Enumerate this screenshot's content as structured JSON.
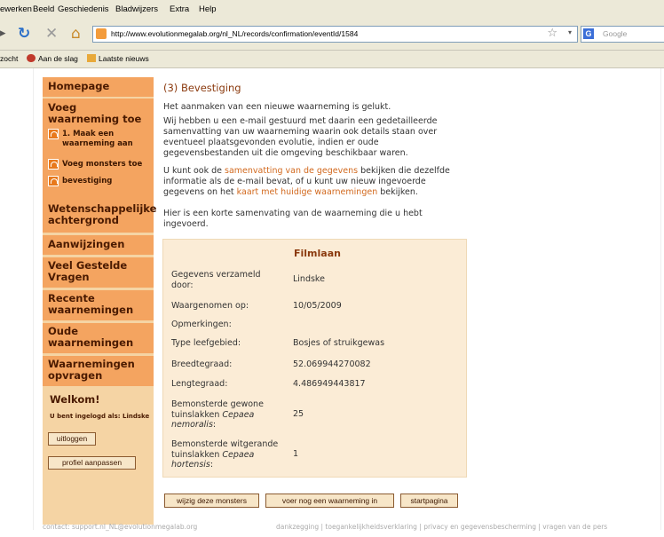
{
  "menu": [
    "ewerken",
    "Beeld",
    "Geschiedenis",
    "Bladwijzers",
    "Extra",
    "Help"
  ],
  "nav": {
    "url": "http://www.evolutionmegalab.org/nl_NL/records/confirmation/eventId/1584",
    "search_placeholder": "Google"
  },
  "bookmarks": [
    "zocht",
    "Aan de slag",
    "Laatste nieuws"
  ],
  "sidebar": {
    "homepage": "Homepage",
    "add_observation": "Voeg waarneming toe",
    "steps": [
      "1. Maak een waarneming aan",
      "Voeg monsters toe",
      "bevestiging"
    ],
    "science": "Wetenschappelijke achtergrond",
    "instructions": "Aanwijzingen",
    "faq": "Veel Gestelde Vragen",
    "recent": "Recente waarnemingen",
    "old": "Oude waarnemingen",
    "query": "Waarnemingen opvragen",
    "welcome_title": "Welkom!",
    "logged_in": "U bent ingelogd als: Lindske",
    "logout": "uitloggen",
    "edit_profile": "profiel aanpassen"
  },
  "main": {
    "title": "(3) Bevestiging",
    "p1": "Het aanmaken van een nieuwe waarneming is gelukt.",
    "p2": "Wij hebben u een e-mail gestuurd met daarin een gedetailleerde samenvatting van uw waarneming waarin ook details staan over eventueel plaatsgevonden evolutie, indien er oude gegevensbestanden uit die omgeving beschikbaar waren.",
    "p3_a": "U kunt ook de ",
    "p3_link1": "samenvatting van de gegevens",
    "p3_b": " bekijken die dezelfde informatie als de e-mail bevat, of u kunt uw nieuw ingevoerde gegevens on het ",
    "p3_link2": "kaart met huidige waarnemingen",
    "p3_c": " bekijken.",
    "p4": "Hier is een korte samenvating van de waarneming die u hebt ingevoerd."
  },
  "summary": {
    "title": "Filmlaan",
    "collected_by_label": "Gegevens verzameld door:",
    "collected_by": "Lindske",
    "date_label": "Waargenomen op:",
    "date": "10/05/2009",
    "notes_label": "Opmerkingen:",
    "habitat_label": "Type leefgebied:",
    "habitat": "Bosjes of struikgewas",
    "lat_label": "Breedtegraad:",
    "lat": "52.069944270082",
    "lon_label": "Lengtegraad:",
    "lon": "4.486949443817",
    "common_label_a": "Bemonsterde gewone tuinslakken ",
    "common_label_i": "Cepaea nemoralis",
    "common_label_b": ":",
    "common_count": "25",
    "white_label_a": "Bemonsterde witgerande tuinslakken ",
    "white_label_i": "Cepaea hortensis",
    "white_label_b": ":",
    "white_count": "1"
  },
  "actions": {
    "edit": "wijzig deze monsters",
    "another": "voer nog een waarneming in",
    "start": "startpagina"
  },
  "footer": {
    "contact": "contact: support.nl_NL@evolutionmegalab.org",
    "links": "dankzegging | toegankelijkheidsverklaring | privacy en gegevensbescherming | vragen van de pers"
  }
}
